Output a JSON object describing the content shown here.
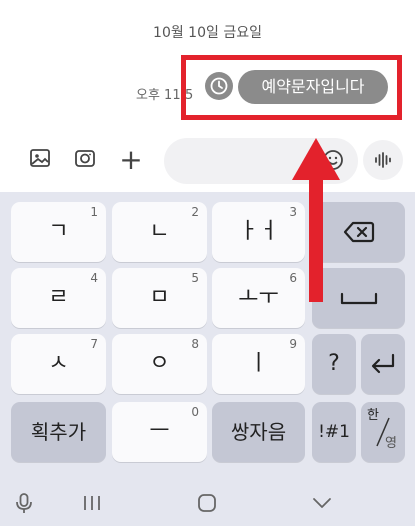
{
  "chat": {
    "date_label": "10월 10일 금요일",
    "time_label": "오후 11:5",
    "scheduled_message": "예약문자입니다"
  },
  "composer": {
    "input_value": "",
    "icons": [
      "image-icon",
      "camera-icon",
      "plus-icon",
      "emoji-icon",
      "voice-icon"
    ]
  },
  "keyboard": {
    "rows": [
      [
        {
          "label": "ㄱ",
          "num": "1"
        },
        {
          "label": "ㄴ",
          "num": "2"
        },
        {
          "label": "ㅏㅓ",
          "num": "3"
        }
      ],
      [
        {
          "label": "ㄹ",
          "num": "4"
        },
        {
          "label": "ㅁ",
          "num": "5"
        },
        {
          "label": "ㅗㅜ",
          "num": "6"
        }
      ],
      [
        {
          "label": "ㅅ",
          "num": "7"
        },
        {
          "label": "ㅇ",
          "num": "8"
        },
        {
          "label": "ㅣ",
          "num": "9"
        }
      ],
      [
        {
          "label": "ㅡ",
          "num": "0"
        }
      ]
    ],
    "question_key": "?",
    "add_stroke_key": "획추가",
    "double_consonant_key": "쌍자음",
    "symbol_key": "!#1",
    "lang_key_top": "한",
    "lang_key_bottom": "영"
  },
  "colors": {
    "highlight": "#e3222c",
    "bubble": "#8b8b8b",
    "keyboard_bg": "#e4e6ef",
    "key_light": "#fafafc",
    "key_dark": "#c4c7d4"
  }
}
